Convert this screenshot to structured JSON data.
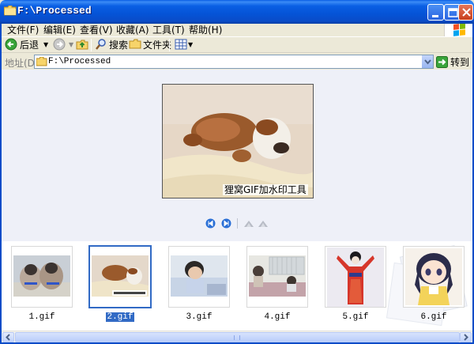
{
  "window": {
    "title": "F:\\Processed",
    "controls": [
      "minimize-icon",
      "maximize-icon",
      "close-icon"
    ]
  },
  "menubar": {
    "items": [
      {
        "label": "文件(F)"
      },
      {
        "label": "编辑(E)"
      },
      {
        "label": "查看(V)"
      },
      {
        "label": "收藏(A)"
      },
      {
        "label": "工具(T)"
      },
      {
        "label": "帮助(H)"
      }
    ]
  },
  "toolbar": {
    "back_label": "后退",
    "search_label": "搜索",
    "folders_label": "文件夹"
  },
  "addressbar": {
    "label": "地址(D)",
    "value": "F:\\Processed",
    "go_label": "转到"
  },
  "preview": {
    "caption": "狸窝GIF加水印工具"
  },
  "filmstrip": {
    "items": [
      {
        "label": "1.gif",
        "selected": false
      },
      {
        "label": "2.gif",
        "selected": true
      },
      {
        "label": "3.gif",
        "selected": false
      },
      {
        "label": "4.gif",
        "selected": false
      },
      {
        "label": "5.gif",
        "selected": false
      },
      {
        "label": "6.gif",
        "selected": false
      }
    ]
  },
  "colors": {
    "titlebar": "#0a5fe4",
    "selection": "#316ac5",
    "preview_bg": "#eef0f8"
  }
}
